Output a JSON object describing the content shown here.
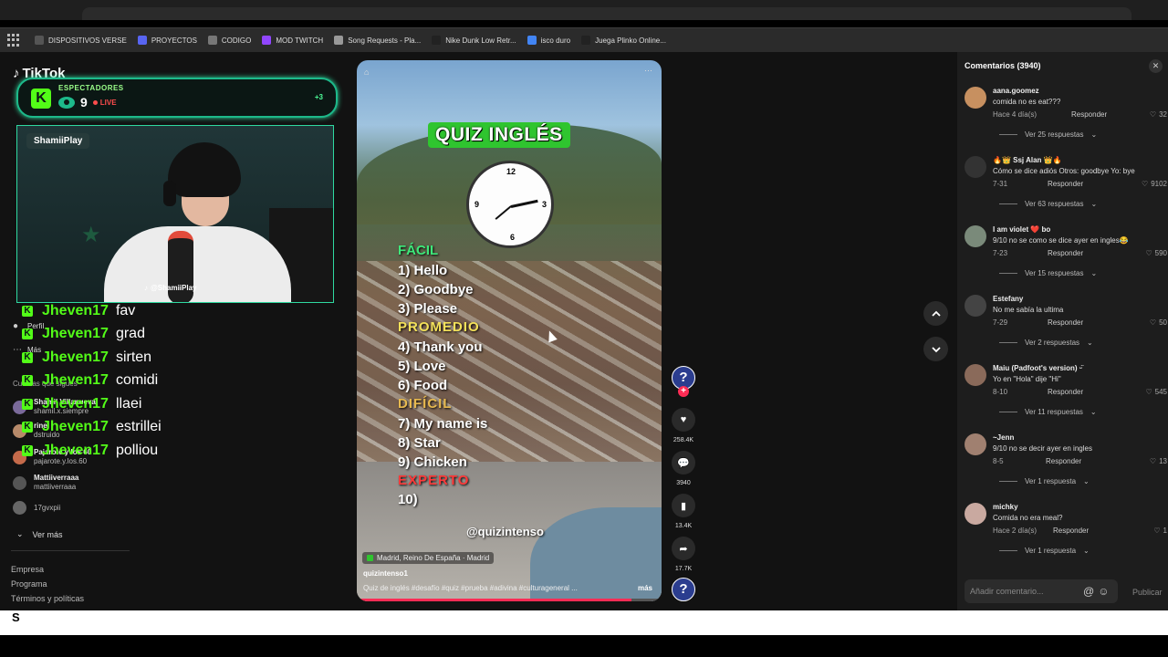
{
  "bookmarks": [
    {
      "label": "DISPOSITIVOS VERSE",
      "icon": "folder-icon",
      "color": "#555555"
    },
    {
      "label": "PROYECTOS",
      "icon": "code-icon",
      "color": "#5865f2"
    },
    {
      "label": "CODIGO",
      "icon": "code-icon",
      "color": "#777777"
    },
    {
      "label": "MOD TWITCH",
      "icon": "twitch-icon",
      "color": "#9146ff"
    },
    {
      "label": "Song Requests - Pla...",
      "icon": "gear-icon",
      "color": "#999999"
    },
    {
      "label": "Nike Dunk Low Retr...",
      "icon": "nike-icon",
      "color": "#222222"
    },
    {
      "label": "isco duro",
      "icon": "google-icon",
      "color": "#4285f4"
    },
    {
      "label": "Juega Plinko Online...",
      "icon": "s-icon",
      "color": "#222222"
    }
  ],
  "tiktok": {
    "logo": "TikTok"
  },
  "sidebar": {
    "nav": [
      {
        "label": "Perfil",
        "icon": "profile-icon"
      },
      {
        "label": "Más",
        "icon": "more-icon"
      }
    ],
    "section_label": "Cuentas que sigues",
    "accounts": [
      {
        "name": "Shamil Villanueva",
        "handle": "shamil.x.siempre",
        "color": "#7a6a9a"
      },
      {
        "name": "rinel",
        "handle": "dstruido",
        "color": "#b78a6a"
      },
      {
        "name": "Pajarote y los 60",
        "handle": "pajarote.y.los.60",
        "color": "#c46a4a"
      },
      {
        "name": "Mattiiverraaa",
        "handle": "mattiiverraaa",
        "color": "#555555"
      },
      {
        "name": "",
        "handle": "17gvxpii",
        "color": "#666666"
      }
    ],
    "ver_mas": "Ver más",
    "footer": [
      "Empresa",
      "Programa",
      "Términos y políticas"
    ]
  },
  "stream": {
    "kick_title": "ESPECTADORES",
    "viewers": "9",
    "live": "LIVE",
    "plus": "+3",
    "cam_name": "ShamiiPlay",
    "cam_handle": "@ShamiiPlay",
    "chat": [
      {
        "user": "Jheven17",
        "msg": "fav"
      },
      {
        "user": "Jheven17",
        "msg": "grad"
      },
      {
        "user": "Jheven17",
        "msg": "sirten"
      },
      {
        "user": "Jheven17",
        "msg": "comidi"
      },
      {
        "user": "Jheven17",
        "msg": "llaei"
      },
      {
        "user": "Jheven17",
        "msg": "estrillei"
      },
      {
        "user": "Jheven17",
        "msg": "polliou"
      }
    ]
  },
  "video": {
    "title": "QUIZ INGLÉS",
    "levels": {
      "facil": "FÁCIL",
      "promedio": "PROMEDIO",
      "dificil": "DIFÍCIL",
      "experto": "EXPERTO"
    },
    "questions": [
      "1) Hello",
      "2) Goodbye",
      "3) Please",
      "4) Thank you",
      "5) Love",
      "6) Food",
      "7) My name is",
      "8) Star",
      "9) Chicken",
      "10)"
    ],
    "overlay_handle": "@quizintenso",
    "location": "Madrid, Reino De España · Madrid",
    "author": "quizintenso1",
    "description": "Quiz de inglés #desafío #quiz #prueba #adivina #culturageneral ...",
    "mas": "más",
    "progress": 0.9
  },
  "rail": {
    "likes": "258.4K",
    "comments": "3940",
    "saves": "13.4K",
    "shares": "17.7K"
  },
  "comments": {
    "header": "Comentarios (3940)",
    "reply_label": "Responder",
    "items": [
      {
        "user": "aana.goomez",
        "text": "comida no es eat???",
        "date": "Hace 4 día(s)",
        "likes": "32",
        "more": "Ver 25 respuestas",
        "color": "#c79060"
      },
      {
        "user": "🔥👑 Ssj Alan 👑🔥",
        "text": "Cómo se dice adiós Otros: goodbye Yo: bye",
        "date": "7-31",
        "likes": "9102",
        "more": "Ver 63 respuestas",
        "color": "#333333"
      },
      {
        "user": "I am violet ❤️ bo",
        "text": "9/10 no se como se dice ayer en ingles😂",
        "date": "7-23",
        "likes": "590",
        "more": "Ver 15 respuestas",
        "color": "#7a8a7a"
      },
      {
        "user": "Estefany",
        "text": "No me sabía la ultima",
        "date": "7-29",
        "likes": "50",
        "more": "Ver 2 respuestas",
        "color": "#444444"
      },
      {
        "user": "Maiu (Padfoot's version) ᵕ̈",
        "text": "Yo en \"Hola\" dije \"Hi\"",
        "date": "8-10",
        "likes": "545",
        "more": "Ver 11 respuestas",
        "color": "#8a6a5a"
      },
      {
        "user": "~Jenn",
        "text": "9/10 no se decir ayer en ingles",
        "date": "8-5",
        "likes": "13",
        "more": "Ver 1 respuesta",
        "color": "#a08070"
      },
      {
        "user": "michky",
        "text": "Comida no era meal?",
        "date": "Hace 2 día(s)",
        "likes": "1",
        "more": "Ver 1 respuesta",
        "color": "#c9a9a0"
      }
    ],
    "input_placeholder": "Añadir comentario...",
    "publish": "Publicar"
  }
}
